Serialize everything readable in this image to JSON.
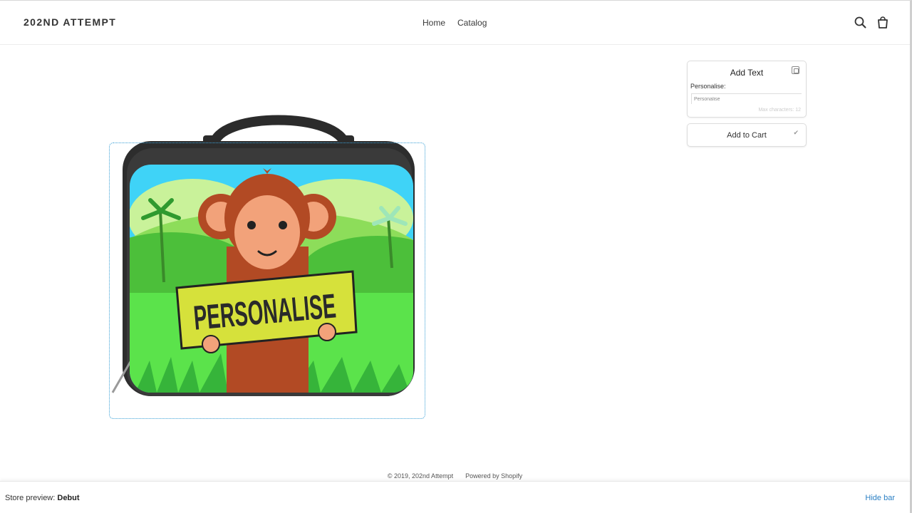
{
  "header": {
    "logo": "202ND ATTEMPT",
    "nav": [
      "Home",
      "Catalog"
    ],
    "search_icon": "search-icon",
    "cart_icon": "shopping-bag-icon"
  },
  "product": {
    "image_text": "PERSONALISE"
  },
  "panel": {
    "title": "Add Text",
    "field_label": "Personalise:",
    "input_placeholder": "Personalise",
    "input_value": "",
    "max_chars": "Max characters: 12",
    "add_to_cart": "Add to Cart"
  },
  "footer": {
    "copyright": "© 2019, 202nd Attempt",
    "powered": "Powered by Shopify"
  },
  "preview_bar": {
    "prefix": "Store preview: ",
    "theme": "Debut",
    "hide": "Hide bar"
  },
  "colors": {
    "accent_link": "#2a7fc4",
    "frame": "#3aa0d6"
  }
}
